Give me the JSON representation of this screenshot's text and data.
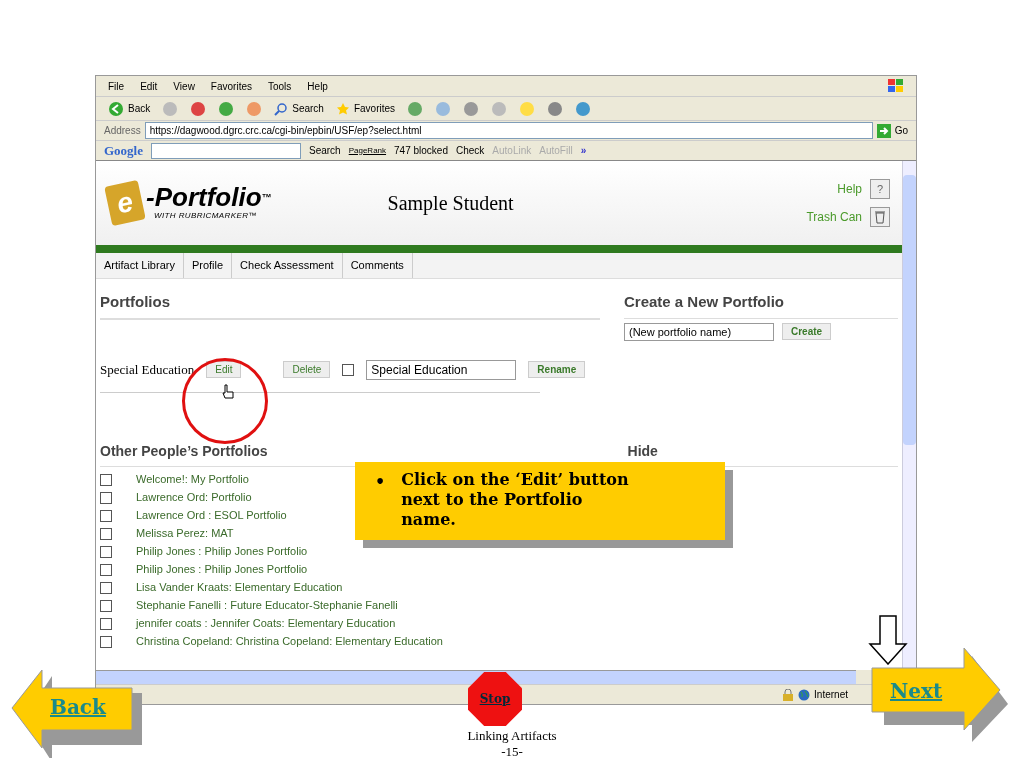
{
  "menu": [
    "File",
    "Edit",
    "View",
    "Favorites",
    "Tools",
    "Help"
  ],
  "toolbar": {
    "back": "Back",
    "search": "Search",
    "favorites": "Favorites"
  },
  "address": {
    "label": "Address",
    "url": "https://dagwood.dgrc.crc.ca/cgi-bin/epbin/USF/ep?select.html",
    "go": "Go"
  },
  "google_bar": {
    "logo": "Google",
    "search": "Search",
    "pagerank": "PageRank",
    "blocked": "747 blocked",
    "check": "Check",
    "autolink": "AutoLink",
    "autofill": "AutoFill",
    "more": "»"
  },
  "site": {
    "logo_e": "e",
    "logo_main": "-Portfolio",
    "logo_tm": "™",
    "logo_sub": "WITH RUBRICMARKER™",
    "student": "Sample Student",
    "help": "Help",
    "help_icon": "?",
    "trash": "Trash Can"
  },
  "tabs": [
    {
      "label": "Artifact Library",
      "selected": false
    },
    {
      "label": "Profile",
      "selected": false
    },
    {
      "label": "Check Assessment",
      "selected": false
    },
    {
      "label": "Comments",
      "selected": false
    }
  ],
  "portfolios": {
    "heading": "Portfolios",
    "rows": [
      {
        "name": "Special Education",
        "edit": "Edit",
        "delete": "Delete",
        "checked": false,
        "rename_value": "Special Education",
        "rename": "Rename"
      }
    ]
  },
  "create": {
    "heading": "Create a New Portfolio",
    "value": "(New portfolio name)",
    "button": "Create"
  },
  "others": {
    "heading": "Other People’s Portfolios",
    "hide": "Hide",
    "items": [
      {
        "label": "Welcome!: My Portfolio",
        "checked": false
      },
      {
        "label": "Lawrence Ord: Portfolio",
        "checked": false
      },
      {
        "label": "Lawrence Ord : ESOL Portfolio",
        "checked": false
      },
      {
        "label": "Melissa Perez: MAT",
        "checked": false
      },
      {
        "label": "Philip Jones : Philip Jones Portfolio",
        "checked": false
      },
      {
        "label": "Philip Jones : Philip Jones Portfolio",
        "checked": false
      },
      {
        "label": "Lisa Vander Kraats: Elementary Education",
        "checked": false
      },
      {
        "label": "Stephanie Fanelli : Future Educator-Stephanie Fanelli",
        "checked": false
      },
      {
        "label": "jennifer coats : Jennifer Coats: Elementary Education",
        "checked": false
      },
      {
        "label": "Christina Copeland: Christina Copeland: Elementary Education",
        "checked": false
      }
    ]
  },
  "status_bar": {
    "zone": "Internet"
  },
  "callout_bullet": "•",
  "callout": "Click on the ‘Edit’ button next to the Portfolio name.",
  "slide": {
    "back": "Back",
    "stop": "Stop",
    "next": "Next",
    "title": "Linking Artifacts",
    "page": "-15-"
  }
}
